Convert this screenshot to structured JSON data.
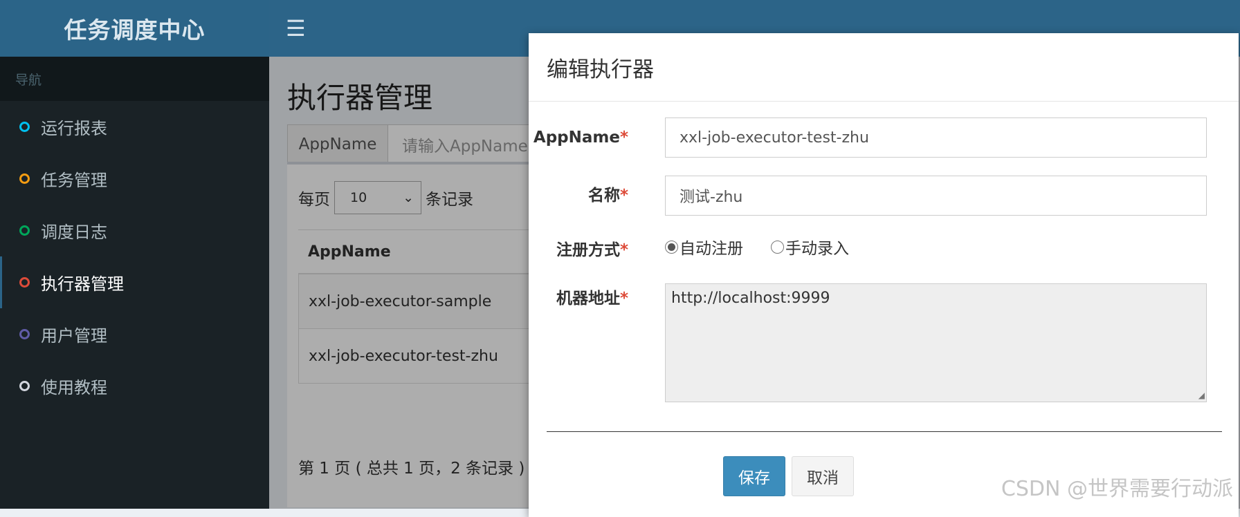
{
  "sidebar": {
    "logo": "任务调度中心",
    "nav_header": "导航",
    "items": [
      {
        "label": "运行报表",
        "color": "#00c0ef"
      },
      {
        "label": "任务管理",
        "color": "#f39c12"
      },
      {
        "label": "调度日志",
        "color": "#00a65a"
      },
      {
        "label": "执行器管理",
        "color": "#dd4b39",
        "active": true
      },
      {
        "label": "用户管理",
        "color": "#605ca8"
      },
      {
        "label": "使用教程",
        "color": "#d2d6de"
      }
    ]
  },
  "topbar": {
    "menu_icon": "hamburger-icon"
  },
  "content": {
    "title": "执行器管理",
    "search": {
      "addon": "AppName",
      "placeholder": "请输入AppName"
    },
    "perpage": {
      "prefix": "每页",
      "value": "10",
      "suffix": "条记录"
    },
    "table": {
      "header": "AppName",
      "rows": [
        "xxl-job-executor-sample",
        "xxl-job-executor-test-zhu"
      ]
    },
    "pager": "第 1 页 ( 总共 1 页，2 条记录 )"
  },
  "modal": {
    "title": "编辑执行器",
    "fields": {
      "appname": {
        "label": "AppName",
        "value": "xxl-job-executor-test-zhu"
      },
      "name": {
        "label": "名称",
        "value": "测试-zhu"
      },
      "reg": {
        "label": "注册方式",
        "auto": "自动注册",
        "manual": "手动录入"
      },
      "address": {
        "label": "机器地址",
        "value": "http://localhost:9999"
      }
    },
    "required_mark": "*",
    "save": "保存",
    "cancel": "取消"
  },
  "watermark": "CSDN @世界需要行动派"
}
